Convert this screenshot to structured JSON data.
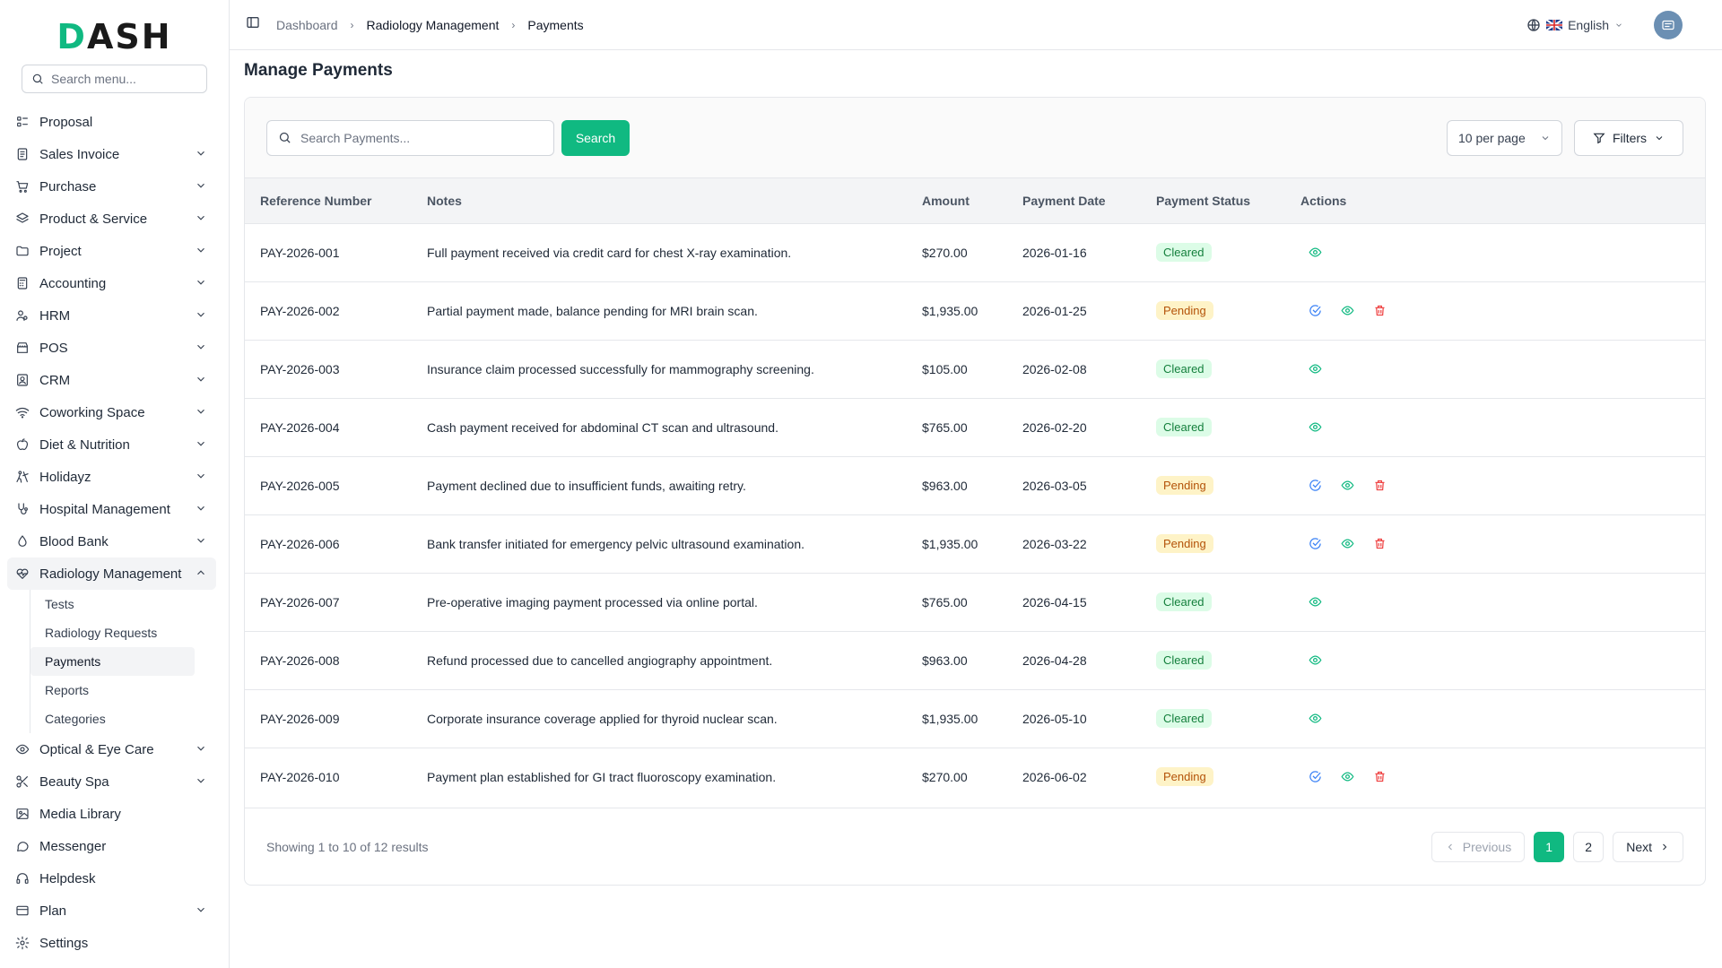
{
  "brand": {
    "logo_text_d": "D",
    "logo_text_rest": "ASH"
  },
  "sidebar": {
    "search_placeholder": "Search menu...",
    "items": [
      {
        "label": "Proposal",
        "icon": "proposal-icon",
        "has_chevron": false
      },
      {
        "label": "Sales Invoice",
        "icon": "invoice-icon",
        "has_chevron": true
      },
      {
        "label": "Purchase",
        "icon": "cart-icon",
        "has_chevron": true
      },
      {
        "label": "Product & Service",
        "icon": "layers-icon",
        "has_chevron": true
      },
      {
        "label": "Project",
        "icon": "folder-icon",
        "has_chevron": true
      },
      {
        "label": "Accounting",
        "icon": "calculator-icon",
        "has_chevron": true
      },
      {
        "label": "HRM",
        "icon": "users-icon",
        "has_chevron": true
      },
      {
        "label": "POS",
        "icon": "store-icon",
        "has_chevron": true
      },
      {
        "label": "CRM",
        "icon": "contact-icon",
        "has_chevron": true
      },
      {
        "label": "Coworking Space",
        "icon": "wifi-icon",
        "has_chevron": true
      },
      {
        "label": "Diet & Nutrition",
        "icon": "apple-icon",
        "has_chevron": true
      },
      {
        "label": "Holidayz",
        "icon": "holiday-icon",
        "has_chevron": true
      },
      {
        "label": "Hospital Management",
        "icon": "stethoscope-icon",
        "has_chevron": true
      },
      {
        "label": "Blood Bank",
        "icon": "droplet-icon",
        "has_chevron": true
      },
      {
        "label": "Radiology Management",
        "icon": "radiology-icon",
        "has_chevron": true,
        "expanded": true
      }
    ],
    "sub_items": [
      {
        "label": "Tests",
        "active": false
      },
      {
        "label": "Radiology Requests",
        "active": false
      },
      {
        "label": "Payments",
        "active": true
      },
      {
        "label": "Reports",
        "active": false
      },
      {
        "label": "Categories",
        "active": false
      }
    ],
    "items_after": [
      {
        "label": "Optical & Eye Care",
        "icon": "eye-icon",
        "has_chevron": true
      },
      {
        "label": "Beauty Spa",
        "icon": "scissors-icon",
        "has_chevron": true
      },
      {
        "label": "Media Library",
        "icon": "image-icon",
        "has_chevron": false
      },
      {
        "label": "Messenger",
        "icon": "message-icon",
        "has_chevron": false
      },
      {
        "label": "Helpdesk",
        "icon": "headset-icon",
        "has_chevron": false
      },
      {
        "label": "Plan",
        "icon": "card-icon",
        "has_chevron": true
      },
      {
        "label": "Settings",
        "icon": "gear-icon",
        "has_chevron": false
      }
    ]
  },
  "header": {
    "breadcrumb": [
      "Dashboard",
      "Radiology Management",
      "Payments"
    ],
    "language": "English"
  },
  "page": {
    "title": "Manage Payments"
  },
  "toolbar": {
    "search_placeholder": "Search Payments...",
    "search_button": "Search",
    "per_page": "10 per page",
    "filters": "Filters"
  },
  "table": {
    "columns": [
      "Reference Number",
      "Notes",
      "Amount",
      "Payment Date",
      "Payment Status",
      "Actions"
    ],
    "rows": [
      {
        "ref": "PAY-2026-001",
        "notes": "Full payment received via credit card for chest X-ray examination.",
        "amount": "$270.00",
        "date": "2026-01-16",
        "status": "Cleared"
      },
      {
        "ref": "PAY-2026-002",
        "notes": "Partial payment made, balance pending for MRI brain scan.",
        "amount": "$1,935.00",
        "date": "2026-01-25",
        "status": "Pending"
      },
      {
        "ref": "PAY-2026-003",
        "notes": "Insurance claim processed successfully for mammography screening.",
        "amount": "$105.00",
        "date": "2026-02-08",
        "status": "Cleared"
      },
      {
        "ref": "PAY-2026-004",
        "notes": "Cash payment received for abdominal CT scan and ultrasound.",
        "amount": "$765.00",
        "date": "2026-02-20",
        "status": "Cleared"
      },
      {
        "ref": "PAY-2026-005",
        "notes": "Payment declined due to insufficient funds, awaiting retry.",
        "amount": "$963.00",
        "date": "2026-03-05",
        "status": "Pending"
      },
      {
        "ref": "PAY-2026-006",
        "notes": "Bank transfer initiated for emergency pelvic ultrasound examination.",
        "amount": "$1,935.00",
        "date": "2026-03-22",
        "status": "Pending"
      },
      {
        "ref": "PAY-2026-007",
        "notes": "Pre-operative imaging payment processed via online portal.",
        "amount": "$765.00",
        "date": "2026-04-15",
        "status": "Cleared"
      },
      {
        "ref": "PAY-2026-008",
        "notes": "Refund processed due to cancelled angiography appointment.",
        "amount": "$963.00",
        "date": "2026-04-28",
        "status": "Cleared"
      },
      {
        "ref": "PAY-2026-009",
        "notes": "Corporate insurance coverage applied for thyroid nuclear scan.",
        "amount": "$1,935.00",
        "date": "2026-05-10",
        "status": "Cleared"
      },
      {
        "ref": "PAY-2026-010",
        "notes": "Payment plan established for GI tract fluoroscopy examination.",
        "amount": "$270.00",
        "date": "2026-06-02",
        "status": "Pending"
      }
    ]
  },
  "pagination": {
    "summary": "Showing 1 to 10 of 12 results",
    "previous": "Previous",
    "pages": [
      "1",
      "2"
    ],
    "current": "1",
    "next": "Next"
  },
  "colors": {
    "accent": "#10b981",
    "cleared_bg": "#dcfce7",
    "cleared_text": "#15803d",
    "pending_bg": "#fef3c7",
    "pending_text": "#b45309",
    "delete": "#ef4444",
    "edit": "#3b82f6"
  }
}
